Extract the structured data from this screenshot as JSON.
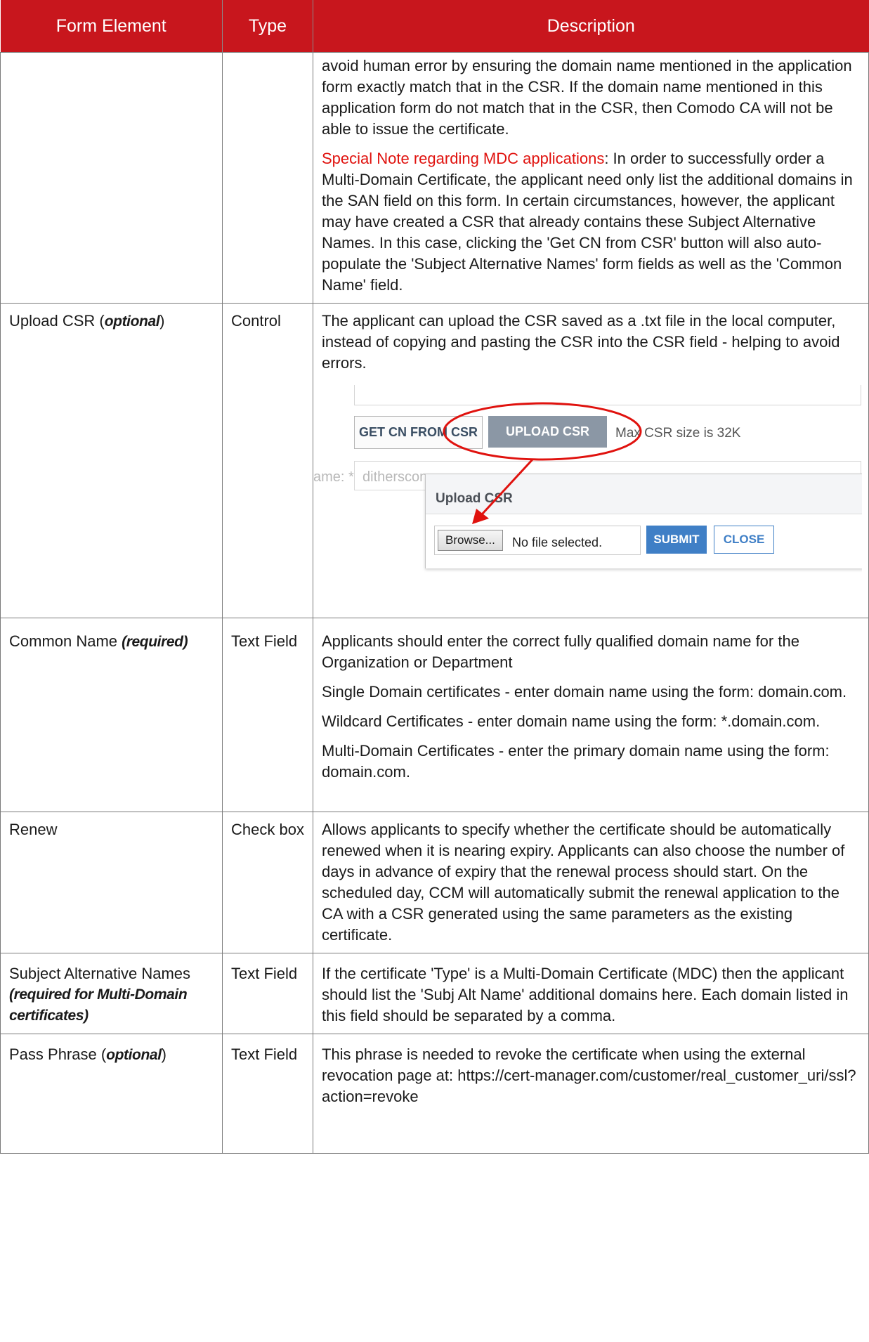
{
  "header": {
    "col1": "Form Element",
    "col2": "Type",
    "col3": "Description"
  },
  "row_continued": {
    "desc_p1": "avoid human error by ensuring the domain name mentioned in the application form exactly match that in the CSR. If the domain name mentioned in this application form do not match that in the CSR, then Comodo CA will not be able to issue the certificate.",
    "note_label": "Special Note regarding MDC applications",
    "note_text": ": In order to successfully order a Multi-Domain Certificate, the applicant need only list the additional domains in the SAN field on this form. In certain circumstances, however, the applicant may have created a CSR that already contains these Subject Alternative Names. In this case, clicking the 'Get CN from CSR' button will also auto-populate the 'Subject Alternative Names' form fields as well as the 'Common Name' field."
  },
  "row_upload": {
    "element": "Upload CSR (",
    "element_em": "optional",
    "element_end": ")",
    "type": "Control",
    "desc": "The applicant can upload the CSR saved as a .txt file in the local computer, instead of copying and pasting the CSR into the CSR field - helping to avoid errors.",
    "shot": {
      "getcn_label": "GET CN FROM CSR",
      "upload_label": "UPLOAD CSR",
      "max_text": "Max CSR size is 32K",
      "field_label": "ame: *",
      "field_value": "ditherscons.com",
      "dialog_title": "Upload CSR",
      "browse_label": "Browse...",
      "nofile_text": "No file selected.",
      "submit_label": "SUBMIT",
      "close_label": "CLOSE",
      "annotation_color": "#e0120e"
    }
  },
  "row_cn": {
    "element": "Common Name ",
    "element_em": "(required)",
    "type": "Text Field",
    "p1": "Applicants should enter the correct fully qualified domain name for the Organization or Department",
    "p2": "Single Domain certificates - enter domain name using the form: domain.com.",
    "p3": "Wildcard Certificates - enter domain name using the form: *.domain.com.",
    "p4": "Multi-Domain Certificates - enter the primary domain name using the form: domain.com."
  },
  "row_renew": {
    "element": "Renew",
    "type": "Check box",
    "desc": "Allows applicants to specify whether the certificate should be automatically renewed when it is nearing expiry. Applicants can also choose the number of days in advance of expiry that the renewal process should start. On the scheduled day, CCM will automatically submit the renewal application to the CA with a CSR generated using the same parameters as the existing certificate."
  },
  "row_san": {
    "element": "Subject Alternative Names",
    "element_em": "(required for Multi-Domain certificates)",
    "type": "Text Field",
    "desc": "If the certificate 'Type' is a Multi-Domain Certificate (MDC) then the applicant should list the 'Subj Alt Name' additional domains here. Each domain listed in this field should be separated by a comma."
  },
  "row_pass": {
    "element": "Pass Phrase (",
    "element_em": "optional",
    "element_end": ")",
    "type": "Text Field",
    "desc": "This phrase is needed to revoke the certificate when using the external revocation page at: https://cert-manager.com/customer/real_customer_uri/ssl?action=revoke"
  },
  "colors": {
    "header_bg": "#c8161d",
    "note_red": "#e0120e",
    "border": "#7a7a7a"
  }
}
